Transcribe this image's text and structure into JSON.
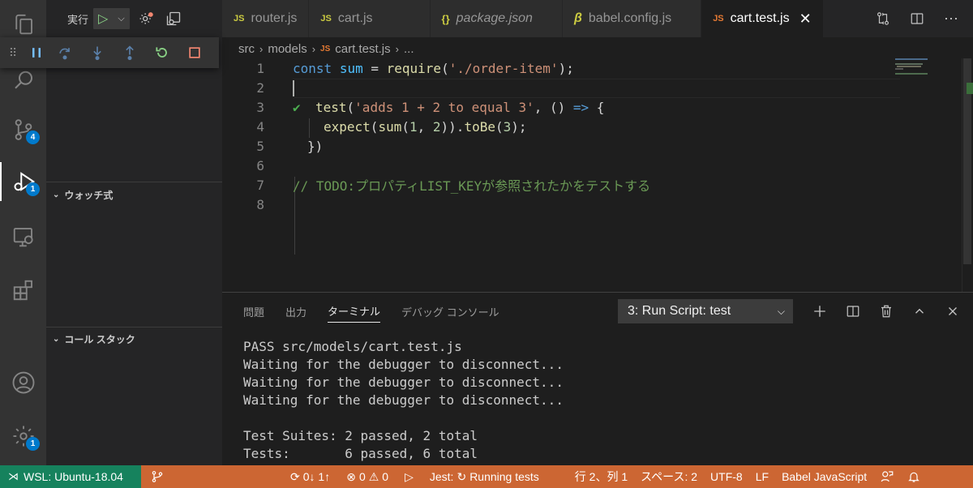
{
  "activity_bar": {
    "source_control_badge": "4",
    "debug_badge": "1",
    "settings_badge": "1"
  },
  "run": {
    "label": "実行"
  },
  "sidebar": {
    "watch_title": "ウォッチ式",
    "callstack_title": "コール スタック"
  },
  "tabs": [
    {
      "icon": "JS",
      "label": "router.js"
    },
    {
      "icon": "JS",
      "label": "cart.js"
    },
    {
      "icon": "{}",
      "label": "package.json"
    },
    {
      "icon": "babel-icon",
      "label": "babel.config.js"
    },
    {
      "icon": "JS",
      "label": "cart.test.js",
      "active": true
    }
  ],
  "breadcrumb": {
    "seg1": "src",
    "seg2": "models",
    "icon": "JS",
    "seg3": "cart.test.js",
    "seg4": "..."
  },
  "editor": {
    "line_numbers": [
      "1",
      "2",
      "3",
      "4",
      "5",
      "6",
      "7",
      "8"
    ],
    "l1": {
      "kw": "const",
      "var": "sum",
      "eq": " = ",
      "fn": "require",
      "open": "(",
      "str": "'./order-item'",
      "close": ");"
    },
    "l3": {
      "fn": "test",
      "open": "(",
      "str": "'adds 1 + 2 to equal 3'",
      "mid": ", () ",
      "arrow": "=>",
      "brace": " {"
    },
    "l4": {
      "fn1": "expect",
      "p1": "(",
      "fn2": "sum",
      "p2": "(",
      "n1": "1",
      "comma": ", ",
      "n2": "2",
      "p3": "))",
      "dot": ".",
      "fn3": "toBe",
      "p4": "(",
      "n3": "3",
      "p5": ");"
    },
    "l5": "})",
    "l7": "// TODO:プロパティLIST_KEYが参照されたかをテストする"
  },
  "panel": {
    "tabs": [
      "問題",
      "出力",
      "ターミナル",
      "デバッグ コンソール"
    ],
    "active_tab": "ターミナル",
    "terminal_select": "3: Run Script: test",
    "terminal_lines": [
      "PASS src/models/cart.test.js",
      "Waiting for the debugger to disconnect...",
      "Waiting for the debugger to disconnect...",
      "Waiting for the debugger to disconnect...",
      "",
      "Test Suites: 2 passed, 2 total",
      "Tests:       6 passed, 6 total"
    ]
  },
  "statusbar": {
    "remote": "WSL: Ubuntu-18.04",
    "sync": "0↓ 1↑",
    "errors": "0",
    "warnings": "0",
    "jest": "Jest:",
    "jest_status": "Running tests",
    "position": "行 2、列 1",
    "spaces": "スペース: 2",
    "encoding": "UTF-8",
    "eol": "LF",
    "language": "Babel JavaScript"
  },
  "colors": {
    "statusbar_bg": "#cc6633",
    "remote_bg": "#16825d",
    "accent": "#007acc"
  }
}
